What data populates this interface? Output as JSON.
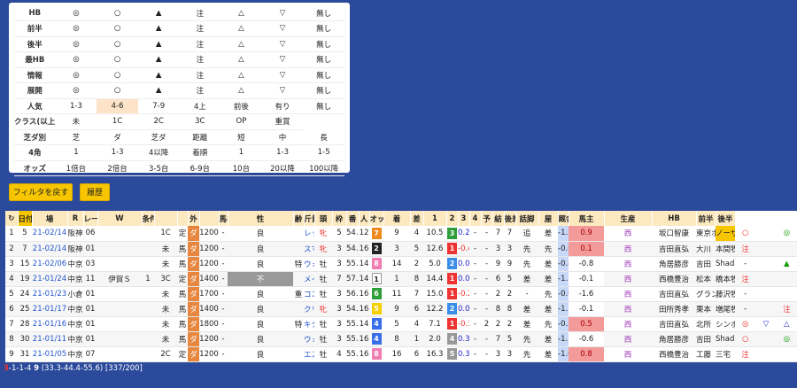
{
  "filters": {
    "rows": [
      {
        "label": "HB",
        "cells": [
          "◎",
          "○",
          "▲",
          "注",
          "△",
          "▽",
          "無し"
        ]
      },
      {
        "label": "前半",
        "cells": [
          "◎",
          "○",
          "▲",
          "注",
          "△",
          "▽",
          "無し"
        ]
      },
      {
        "label": "後半",
        "cells": [
          "◎",
          "○",
          "▲",
          "注",
          "△",
          "▽",
          "無し"
        ]
      },
      {
        "label": "最HB",
        "cells": [
          "◎",
          "○",
          "▲",
          "注",
          "△",
          "▽",
          "無し"
        ]
      },
      {
        "label": "情報",
        "cells": [
          "◎",
          "○",
          "▲",
          "注",
          "△",
          "▽",
          "無し"
        ]
      },
      {
        "label": "展開",
        "cells": [
          "◎",
          "○",
          "▲",
          "注",
          "△",
          "▽",
          "無し"
        ]
      },
      {
        "label": "人気",
        "cells": [
          "1-3",
          "4-6",
          "7-9",
          "4上",
          "前後",
          "有り",
          "無し"
        ]
      },
      {
        "label": "クラス(以上)",
        "cells": [
          "未",
          "1C",
          "2C",
          "3C",
          "OP",
          "重賞"
        ]
      },
      {
        "label": "芝ダ別",
        "cells": [
          "芝",
          "ダ",
          "芝ダ",
          "距離",
          "短",
          "中",
          "長"
        ]
      },
      {
        "label": "4角",
        "cells": [
          "1",
          "1-3",
          "4以降",
          "着順",
          "1",
          "1-3",
          "1-5"
        ]
      },
      {
        "label": "オッズ",
        "cells": [
          "1倍台",
          "2倍台",
          "3-5台",
          "6-9台",
          "10台",
          "20以降",
          "100以降"
        ]
      }
    ],
    "reset_label": "フィルタを戻す",
    "history_label": "履歴"
  },
  "results": {
    "headers": [
      "",
      "日付",
      "場",
      "R",
      "レース名",
      "W",
      "条件",
      "",
      "",
      "外",
      "",
      "馬名",
      "性",
      "齢",
      "斤量",
      "頭",
      "枠",
      "番",
      "人",
      "オッズ",
      "着",
      "差",
      "1",
      "2",
      "3",
      "4",
      "予",
      "結",
      "後差",
      "話脚",
      "屋",
      "厩舎",
      "馬主",
      "生産",
      "HB",
      "前半",
      "後半"
    ],
    "rows": [
      {
        "no": "1",
        "cnt": "5",
        "date": "21-02/14",
        "track": "阪神",
        "r": "06",
        "race": "",
        "w": "",
        "cond": "1C",
        "ct": "定",
        "tf": "ダ",
        "dist": "1200",
        "out": "-",
        "grd": "良",
        "mk": "",
        "horse": "レッドモアナ",
        "sex": "牝",
        "age": "5",
        "kin": "54.0",
        "heads": "12",
        "waku": "7",
        "ban": "9",
        "pop": "4",
        "odds": "10.5",
        "chaku": "3",
        "sa": "0.2",
        "c1": "-",
        "c2": "-",
        "c3": "7",
        "c4": "7",
        "yo": "追",
        "ke": "差",
        "kosa": "-1.1",
        "wa": "0.9",
        "ya": "西",
        "trainer": "坂口智康",
        "owner": "東京ホースレ",
        "breeder": "ノーザンファ",
        "hb": "○",
        "zen": "",
        "kou": "◎"
      },
      {
        "no": "2",
        "cnt": "7",
        "date": "21-02/14",
        "track": "阪神",
        "r": "01",
        "race": "",
        "w": "",
        "cond": "未",
        "ct": "馬",
        "tf": "ダ",
        "dist": "1200",
        "out": "-",
        "grd": "良",
        "mk": "",
        "horse": "スマートネクタル",
        "sex": "牝",
        "age": "3",
        "kin": "54.0",
        "heads": "16",
        "waku": "2",
        "ban": "3",
        "pop": "5",
        "odds": "12.6",
        "chaku": "1",
        "sa": "-0.4",
        "c1": "-",
        "c2": "-",
        "c3": "3",
        "c4": "3",
        "yo": "先",
        "ke": "先",
        "kosa": "-0.6",
        "wa": "0.1",
        "ya": "西",
        "trainer": "吉田直弘",
        "owner": "大川　徹",
        "breeder": "本間牧場",
        "hb": "注",
        "zen": "",
        "kou": ""
      },
      {
        "no": "3",
        "cnt": "15",
        "date": "21-02/06",
        "track": "中京",
        "r": "03",
        "race": "",
        "w": "",
        "cond": "未",
        "ct": "馬",
        "tf": "ダ",
        "dist": "1200",
        "out": "-",
        "grd": "良",
        "mk": "特",
        "horse": "ウォータークレスト",
        "sex": "牡",
        "age": "3",
        "kin": "55.0",
        "heads": "14",
        "waku": "8",
        "ban": "14",
        "pop": "2",
        "odds": "5.0",
        "chaku": "2",
        "sa": "0.0",
        "c1": "-",
        "c2": "-",
        "c3": "9",
        "c4": "9",
        "yo": "先",
        "ke": "差",
        "kosa": "-0.8",
        "wa": "-0.8",
        "ya": "西",
        "trainer": "角居勝彦",
        "owner": "吉田　千津",
        "breeder": "Shadai",
        "hb": "-",
        "zen": "",
        "kou": "▲"
      },
      {
        "no": "4",
        "cnt": "19",
        "date": "21-01/24",
        "track": "中京",
        "r": "11",
        "race": "伊賀Ｓ",
        "w": "1",
        "cond": "3C",
        "ct": "定",
        "tf": "ダ",
        "dist": "1400",
        "out": "-",
        "grd": "不",
        "mk": "",
        "horse": "メイショウテンセイ",
        "sex": "牡",
        "age": "7",
        "kin": "57.0",
        "heads": "14",
        "waku": "1",
        "ban": "1",
        "pop": "8",
        "odds": "14.4",
        "chaku": "1",
        "sa": "0.0",
        "c1": "-",
        "c2": "-",
        "c3": "6",
        "c4": "5",
        "yo": "差",
        "ke": "差",
        "kosa": "-1.1",
        "wa": "-0.1",
        "ya": "西",
        "trainer": "西橋豊治",
        "owner": "松本　好雄",
        "breeder": "橋本牧場",
        "hb": "注",
        "zen": "",
        "kou": ""
      },
      {
        "no": "5",
        "cnt": "24",
        "date": "21-01/23",
        "track": "小倉",
        "r": "01",
        "race": "",
        "w": "",
        "cond": "未",
        "ct": "馬",
        "tf": "ダ",
        "dist": "1700",
        "out": "-",
        "grd": "良",
        "mk": "重",
        "horse": "コニャックダイヤ",
        "sex": "牡",
        "age": "3",
        "kin": "56.0",
        "heads": "16",
        "waku": "6",
        "ban": "11",
        "pop": "7",
        "odds": "15.0",
        "chaku": "1",
        "sa": "-0.2",
        "c1": "-",
        "c2": "-",
        "c3": "2",
        "c4": "2",
        "yo": "-",
        "ke": "先",
        "kosa": "-0.6",
        "wa": "-1.6",
        "ya": "西",
        "trainer": "吉田直弘",
        "owner": "グランデオー",
        "breeder": "藤沢牧場",
        "hb": "-",
        "zen": "",
        "kou": ""
      },
      {
        "no": "6",
        "cnt": "25",
        "date": "21-01/17",
        "track": "中京",
        "r": "01",
        "race": "",
        "w": "",
        "cond": "未",
        "ct": "馬",
        "tf": "ダ",
        "dist": "1400",
        "out": "-",
        "grd": "良",
        "mk": "",
        "horse": "クリノキララ",
        "sex": "牝",
        "age": "3",
        "kin": "54.0",
        "heads": "16",
        "waku": "5",
        "ban": "9",
        "pop": "6",
        "odds": "12.2",
        "chaku": "2",
        "sa": "0.0",
        "c1": "-",
        "c2": "-",
        "c3": "8",
        "c4": "8",
        "yo": "差",
        "ke": "差",
        "kosa": "-1.1",
        "wa": "-0.1",
        "ya": "西",
        "trainer": "田所秀孝",
        "owner": "栗本　博晴",
        "breeder": "増尾牧場",
        "hb": "-",
        "zen": "",
        "kou": "注"
      },
      {
        "no": "7",
        "cnt": "28",
        "date": "21-01/16",
        "track": "中京",
        "r": "01",
        "race": "",
        "w": "",
        "cond": "未",
        "ct": "馬",
        "tf": "ダ",
        "dist": "1800",
        "out": "-",
        "grd": "良",
        "mk": "特",
        "horse": "キタノインディ",
        "sex": "牡",
        "age": "3",
        "kin": "55.0",
        "heads": "14",
        "waku": "4",
        "ban": "5",
        "pop": "4",
        "odds": "7.1",
        "chaku": "1",
        "sa": "-0.3",
        "c1": "-",
        "c2": "2",
        "c3": "2",
        "c4": "2",
        "yo": "差",
        "ke": "先",
        "kosa": "-0.5",
        "wa": "0.5",
        "ya": "西",
        "trainer": "吉田直弘",
        "owner": "北所　直人",
        "breeder": "シンボリ牧場",
        "hb": "◎",
        "zen": "▽",
        "kou": "△"
      },
      {
        "no": "8",
        "cnt": "30",
        "date": "21-01/11",
        "track": "中京",
        "r": "01",
        "race": "",
        "w": "",
        "cond": "未",
        "ct": "馬",
        "tf": "ダ",
        "dist": "1200",
        "out": "-",
        "grd": "良",
        "mk": "",
        "horse": "ウォータークレスト",
        "sex": "牡",
        "age": "3",
        "kin": "55.0",
        "heads": "16",
        "waku": "4",
        "ban": "8",
        "pop": "1",
        "odds": "2.0",
        "chaku": "4",
        "sa": "0.3",
        "c1": "-",
        "c2": "-",
        "c3": "7",
        "c4": "5",
        "yo": "先",
        "ke": "差",
        "kosa": "-1.1",
        "wa": "-0.6",
        "ya": "西",
        "trainer": "角居勝彦",
        "owner": "吉田　千津",
        "breeder": "Shadai",
        "hb": "○",
        "zen": "",
        "kou": "◎"
      },
      {
        "no": "9",
        "cnt": "31",
        "date": "21-01/05",
        "track": "中京",
        "r": "07",
        "race": "",
        "w": "",
        "cond": "2C",
        "ct": "定",
        "tf": "ダ",
        "dist": "1200",
        "out": "-",
        "grd": "良",
        "mk": "",
        "horse": "エスシーミホーク",
        "sex": "牡",
        "age": "4",
        "kin": "55.0",
        "heads": "16",
        "waku": "8",
        "ban": "16",
        "pop": "6",
        "odds": "16.3",
        "chaku": "5",
        "sa": "0.3",
        "c1": "-",
        "c2": "-",
        "c3": "3",
        "c4": "3",
        "yo": "先",
        "ke": "差",
        "kosa": "-1.0",
        "wa": "0.8",
        "ya": "西",
        "trainer": "西橋豊治",
        "owner": "工藤　圭司",
        "breeder": "三宅　正弘",
        "hb": "注",
        "zen": "",
        "kou": ""
      }
    ]
  },
  "footer": {
    "n1": "3",
    "n2": "-1-1-4",
    "n3": "9",
    "rest": "(33.3-44.4-55.6) [337/200]"
  },
  "colors": {
    "waku": {
      "1": "#ffffff",
      "2": "#222222",
      "3": "#e33",
      "4": "#3a6ee8",
      "5": "#f5d000",
      "6": "#2f9f3a",
      "7": "#f08a1c",
      "8": "#f27db2"
    },
    "chaku": {
      "1": "#e33",
      "2": "#3a8ee8",
      "3": "#2f9f3a",
      "4": "#999",
      "5": "#999"
    }
  }
}
